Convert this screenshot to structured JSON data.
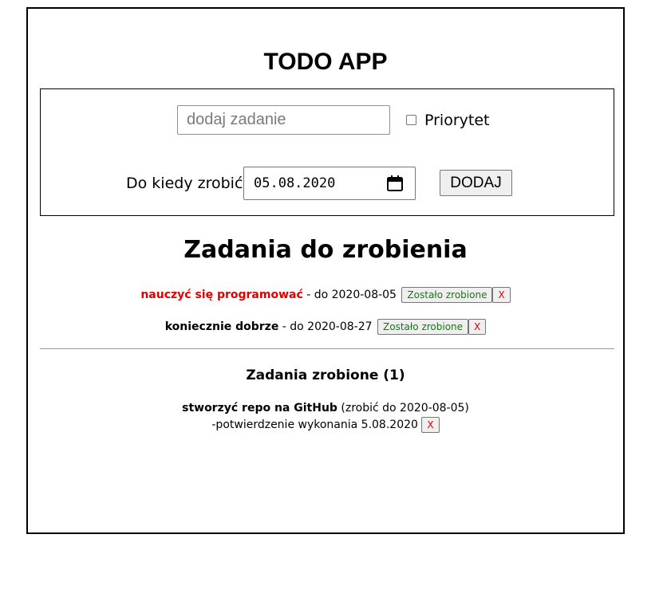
{
  "app": {
    "title": "TODO APP"
  },
  "form": {
    "task_placeholder": "dodaj zadanie",
    "task_value": "",
    "priority_label": "Priorytet",
    "priority_checked": false,
    "deadline_label": "Do kiedy zrobić",
    "date_value": "05.08.2020",
    "add_label": "DODAJ"
  },
  "active": {
    "title": "Zadania do zrobienia",
    "tasks": [
      {
        "name": "nauczyć się programować",
        "priority": true,
        "due_text": " - do 2020-08-05 ",
        "done_label": "Zostało zrobione",
        "delete_label": "X"
      },
      {
        "name": "koniecznie dobrze",
        "priority": false,
        "due_text": " - do 2020-08-27 ",
        "done_label": "Zostało zrobione",
        "delete_label": "X"
      }
    ]
  },
  "done": {
    "title": "Zadania zrobione (1)",
    "tasks": [
      {
        "name": "stworzyć repo na GitHub",
        "due_text": " (zrobić do 2020-08-05)",
        "confirm_text": "-potwierdzenie wykonania 5.08.2020 ",
        "delete_label": "X"
      }
    ]
  },
  "colors": {
    "priority_text": "#e00000",
    "done_button_text": "#137a13",
    "delete_button_text": "#e00000"
  },
  "icons": {
    "calendar": "calendar-icon",
    "checkbox": "checkbox-icon"
  }
}
